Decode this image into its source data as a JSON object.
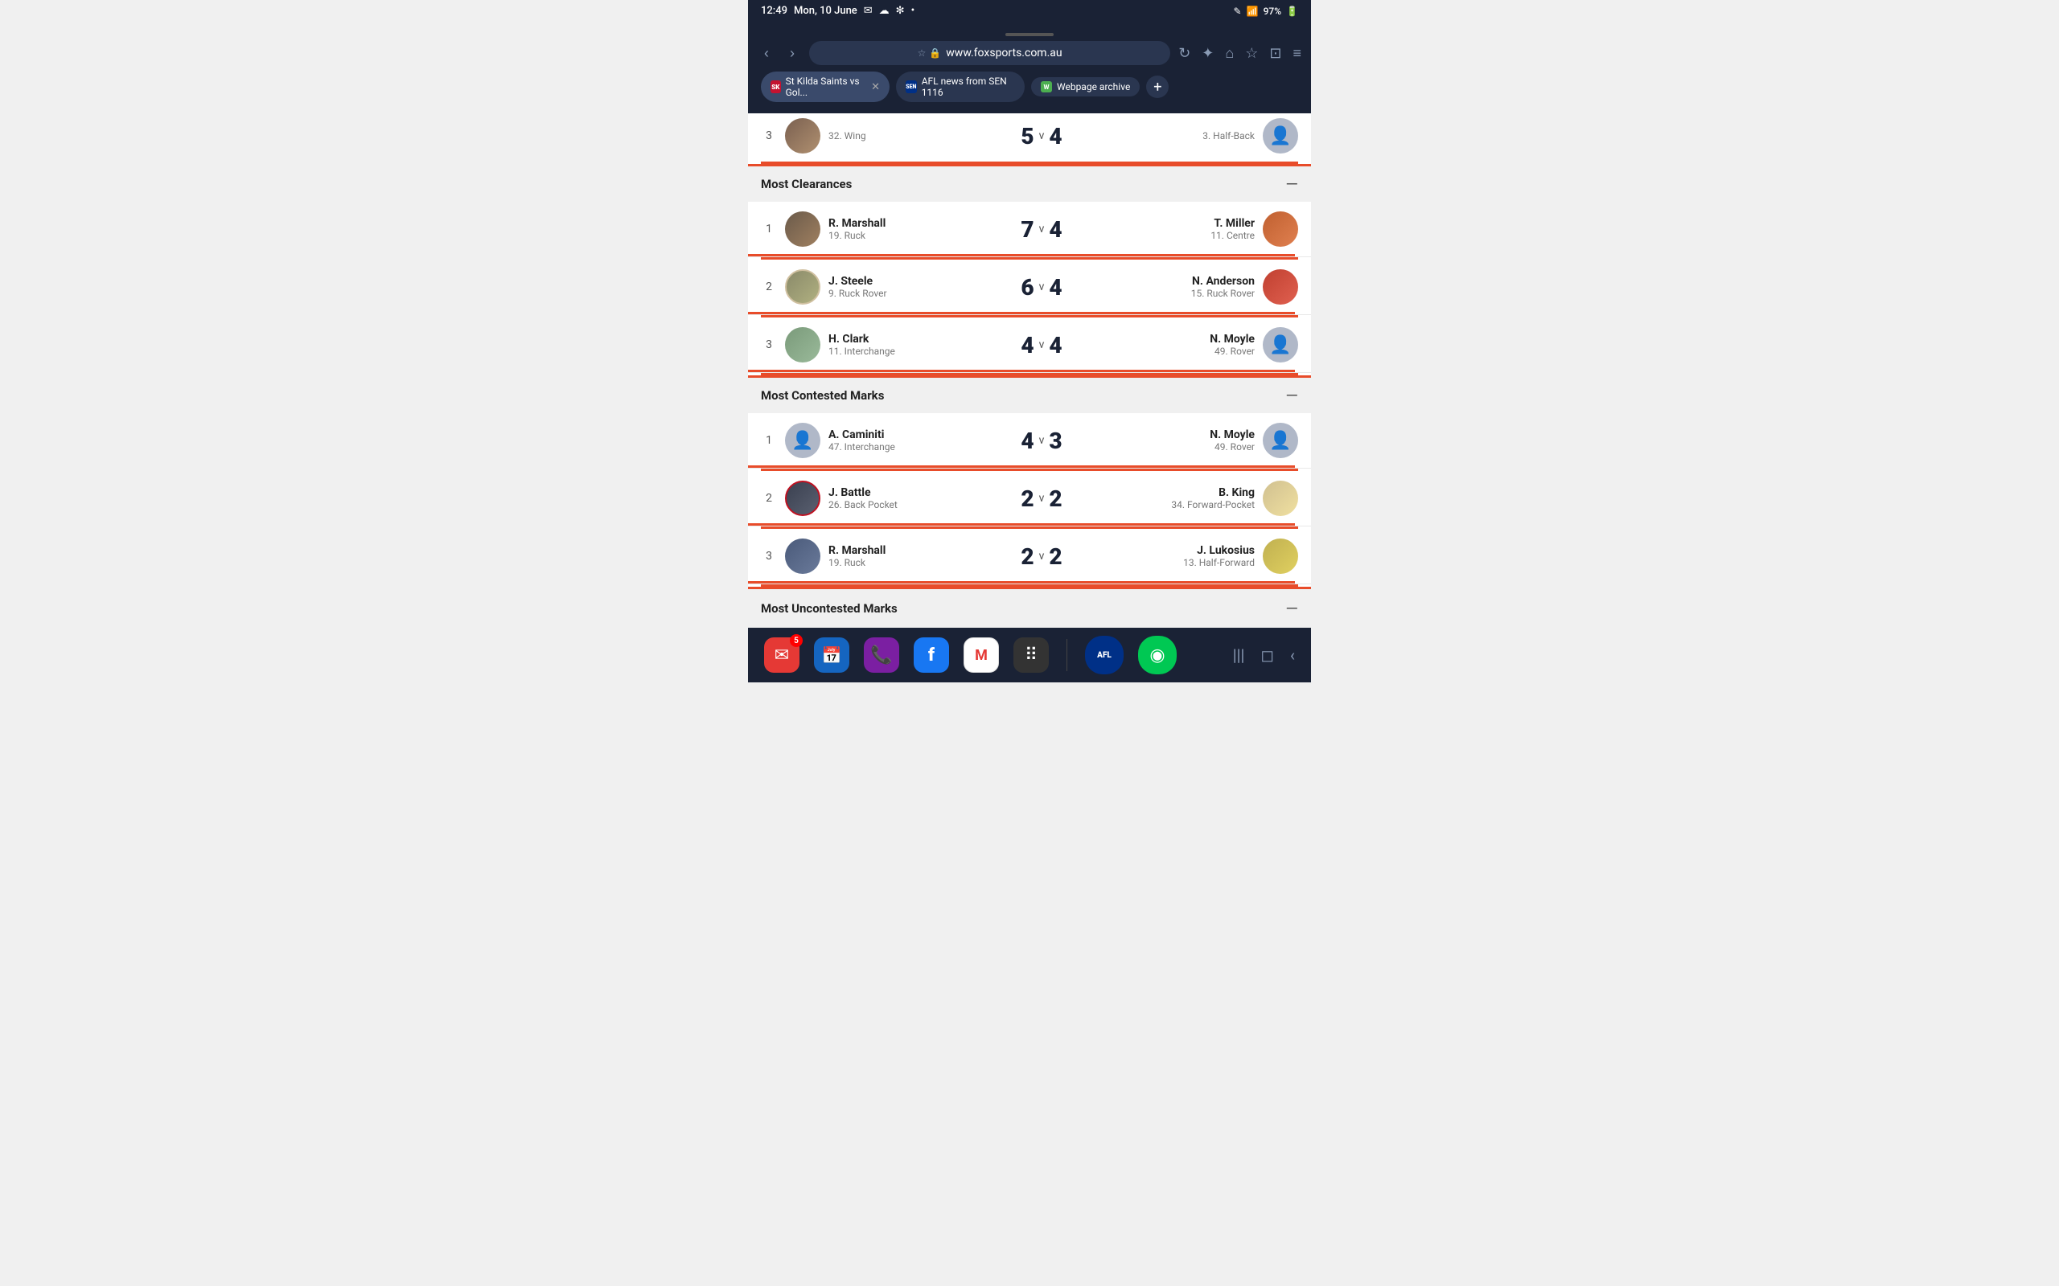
{
  "statusBar": {
    "time": "12:49",
    "date": "Mon, 10 June",
    "battery": "97%",
    "signal": "●●●"
  },
  "browser": {
    "url": "www.foxsports.com.au",
    "tabs": [
      {
        "id": "tab1",
        "favicon": "st-kilda",
        "label": "St Kilda Saints vs Gol...",
        "closeable": true
      },
      {
        "id": "tab2",
        "favicon": "afl",
        "label": "AFL news from SEN 1116",
        "closeable": false
      },
      {
        "id": "tab3",
        "favicon": "webpage",
        "label": "Webpage archive",
        "closeable": false
      }
    ]
  },
  "partialRow": {
    "rank": "3",
    "leftScore": "5",
    "rightScore": "4",
    "leftPos": "32. Wing",
    "rightPos": "3. Half-Back"
  },
  "sections": [
    {
      "id": "most-clearances",
      "title": "Most Clearances",
      "rows": [
        {
          "rank": "1",
          "leftName": "R. Marshall",
          "leftPos": "19. Ruck",
          "leftScore": "7",
          "rightScore": "4",
          "rightName": "T. Miller",
          "rightPos": "11. Centre",
          "leftAvatarType": "photo",
          "rightAvatarType": "photo-orange"
        },
        {
          "rank": "2",
          "leftName": "J. Steele",
          "leftPos": "9. Ruck Rover",
          "leftScore": "6",
          "rightScore": "4",
          "rightName": "N. Anderson",
          "rightPos": "15. Ruck Rover",
          "leftAvatarType": "photo",
          "rightAvatarType": "photo-red"
        },
        {
          "rank": "3",
          "leftName": "H. Clark",
          "leftPos": "11. Interchange",
          "leftScore": "4",
          "rightScore": "4",
          "rightName": "N. Moyle",
          "rightPos": "49. Rover",
          "leftAvatarType": "photo",
          "rightAvatarType": "blank"
        }
      ]
    },
    {
      "id": "most-contested-marks",
      "title": "Most Contested Marks",
      "rows": [
        {
          "rank": "1",
          "leftName": "A. Caminiti",
          "leftPos": "47. Interchange",
          "leftScore": "4",
          "rightScore": "3",
          "rightName": "N. Moyle",
          "rightPos": "49. Rover",
          "leftAvatarType": "blank",
          "rightAvatarType": "blank"
        },
        {
          "rank": "2",
          "leftName": "J. Battle",
          "leftPos": "26. Back Pocket",
          "leftScore": "2",
          "rightScore": "2",
          "rightName": "B. King",
          "rightPos": "34. Forward-Pocket",
          "leftAvatarType": "photo-dark",
          "rightAvatarType": "photo-hat"
        },
        {
          "rank": "3",
          "leftName": "R. Marshall",
          "leftPos": "19. Ruck",
          "leftScore": "2",
          "rightScore": "2",
          "rightName": "J. Lukosius",
          "rightPos": "13. Half-Forward",
          "leftAvatarType": "photo-dark2",
          "rightAvatarType": "photo-blonde"
        }
      ]
    }
  ],
  "partialSection": {
    "title": "Most Uncontested Marks"
  },
  "bottomApps": [
    {
      "id": "email",
      "icon": "✉",
      "color": "#e53935",
      "badge": "5"
    },
    {
      "id": "calendar",
      "icon": "📅",
      "color": "#1565c0",
      "badge": null
    },
    {
      "id": "viber",
      "icon": "📞",
      "color": "#7b1fa2",
      "badge": null
    },
    {
      "id": "facebook",
      "icon": "f",
      "color": "#1877f2",
      "badge": null
    },
    {
      "id": "gmail",
      "icon": "M",
      "color": "white",
      "badge": null
    },
    {
      "id": "grid",
      "icon": "⠿",
      "color": "#444",
      "badge": null
    },
    {
      "id": "afl",
      "icon": "AFL",
      "color": "#003087",
      "badge": null
    },
    {
      "id": "green",
      "icon": "◉",
      "color": "#00c853",
      "badge": null
    }
  ],
  "navControls": [
    "|||",
    "◻",
    "‹"
  ]
}
